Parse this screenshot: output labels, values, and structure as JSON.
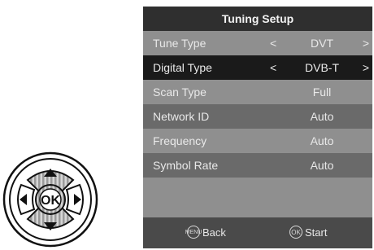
{
  "remote": {
    "ok_label": "OK"
  },
  "menu": {
    "title": "Tuning Setup",
    "rows": [
      {
        "label": "Tune Type",
        "arrow_left": "<",
        "value": "DVT",
        "arrow_right": ">"
      },
      {
        "label": "Digital Type",
        "arrow_left": "<",
        "value": "DVB-T",
        "arrow_right": ">"
      },
      {
        "label": "Scan Type",
        "value": "Full"
      },
      {
        "label": "Network ID",
        "value": "Auto"
      },
      {
        "label": "Frequency",
        "value": "Auto"
      },
      {
        "label": "Symbol Rate",
        "value": "Auto"
      }
    ],
    "footer": {
      "back_badge": "MENU",
      "back_label": "Back",
      "start_badge": "OK",
      "start_label": "Start"
    }
  }
}
